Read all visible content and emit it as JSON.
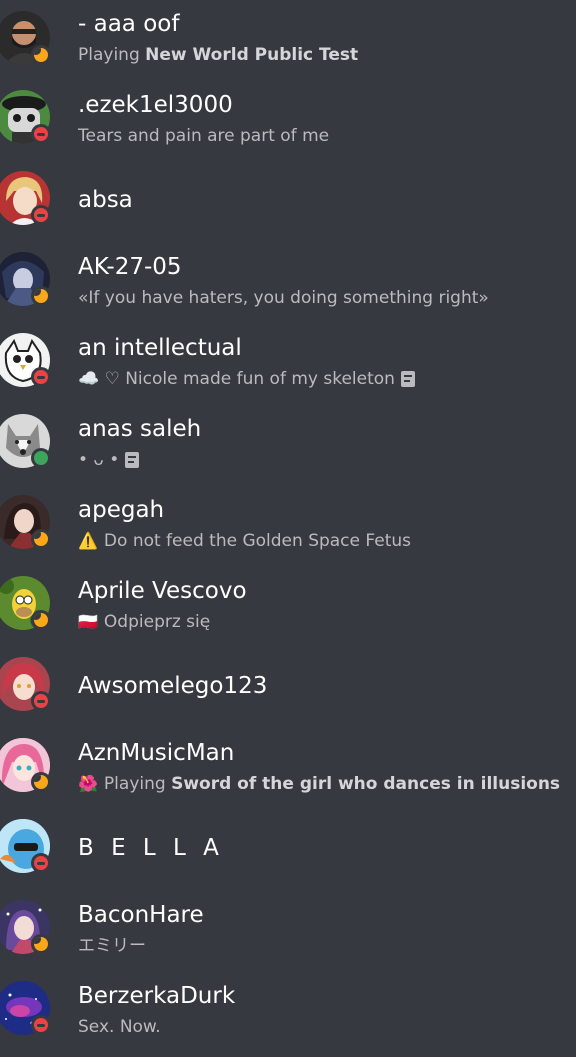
{
  "members": [
    {
      "name": "- aaa oof",
      "activity_prefix": "Playing ",
      "activity_bold": "New World Public Test",
      "status": "idle",
      "avatar_icon": "man-glasses-avatar-icon",
      "avatar_color": "#2b2b2b"
    },
    {
      "name": ".ezek1el3000",
      "activity": "Tears and pain are part of me",
      "status": "dnd",
      "avatar_icon": "skull-mask-avatar-icon",
      "avatar_color": "#4c8a3f"
    },
    {
      "name": "absa",
      "status": "dnd",
      "avatar_icon": "anime-blond-avatar-icon",
      "avatar_color": "#b83434"
    },
    {
      "name": "AK-27-05",
      "activity": "«If you have haters, you doing something right»",
      "status": "idle",
      "avatar_icon": "anime-dark-avatar-icon",
      "avatar_color": "#1d2236"
    },
    {
      "name": "an intellectual",
      "activity": "☁️ ♡ Nicole made fun of my skeleton",
      "status": "dnd",
      "avatar_icon": "owl-drawing-avatar-icon",
      "avatar_color": "#f2f2f2"
    },
    {
      "name": "anas saleh",
      "activity": "• ᴗ •",
      "status": "online",
      "avatar_icon": "husky-avatar-icon",
      "avatar_color": "#d9d9d9"
    },
    {
      "name": "apegah",
      "activity_emoji": "⚠️",
      "activity": "Do not feed the Golden Space Fetus",
      "status": "idle",
      "avatar_icon": "anime-girl-avatar-icon",
      "avatar_color": "#3a2a2a"
    },
    {
      "name": "Aprile Vescovo",
      "activity_emoji": "🇵🇱",
      "activity": "Odpieprz się",
      "status": "idle",
      "avatar_icon": "homer-avatar-icon",
      "avatar_color": "#5c8a2e"
    },
    {
      "name": "Awsomelego123",
      "status": "dnd",
      "avatar_icon": "anime-red-hair-avatar-icon",
      "avatar_color": "#a8454f"
    },
    {
      "name": "AznMusicMan",
      "activity_emoji": "🌺",
      "activity_prefix": "Playing ",
      "activity_bold": "Sword of the girl who dances in illusions",
      "status": "idle",
      "avatar_icon": "anime-pink-hair-avatar-icon",
      "avatar_color": "#d9769b"
    },
    {
      "name": "B E L L A",
      "status": "dnd",
      "avatar_icon": "blue-creature-avatar-icon",
      "avatar_color": "#5fb7e8"
    },
    {
      "name": "BaconHare",
      "activity": "エミリー",
      "status": "idle",
      "avatar_icon": "anime-purple-avatar-icon",
      "avatar_color": "#3b3563"
    },
    {
      "name": "BerzerkaDurk",
      "activity": "Sex. Now.",
      "status": "dnd",
      "avatar_icon": "galaxy-avatar-icon",
      "avatar_color": "#1e2c86"
    }
  ]
}
